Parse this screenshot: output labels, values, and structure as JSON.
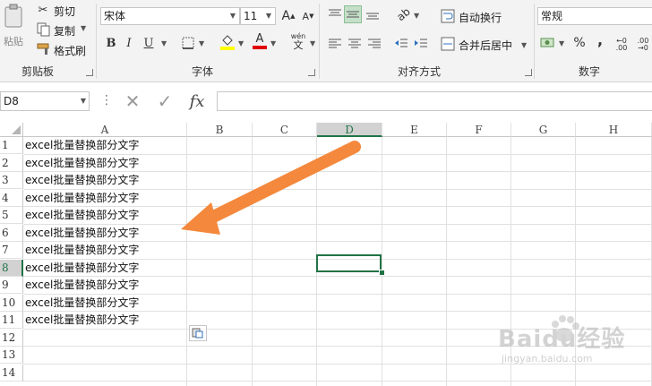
{
  "ribbon": {
    "clipboard": {
      "paste_label": "粘贴",
      "cut_label": "剪切",
      "copy_label": "复制",
      "format_painter_label": "格式刷",
      "group_label": "剪贴板"
    },
    "font": {
      "font_name": "宋体",
      "font_size": "11",
      "bold": "B",
      "italic": "I",
      "underline": "U",
      "grow": "A",
      "shrink": "A",
      "font_color": "A",
      "phonetic": "wén",
      "group_label": "字体"
    },
    "alignment": {
      "wrap_text_label": "自动换行",
      "merge_center_label": "合并后居中",
      "group_label": "对齐方式"
    },
    "number": {
      "format": "常规",
      "percent": "%",
      "comma": ",",
      "group_label": "数字"
    }
  },
  "formula_bar": {
    "name_box": "D8",
    "fx": "fx",
    "formula": ""
  },
  "sheet": {
    "columns": [
      "A",
      "B",
      "C",
      "D",
      "E",
      "F",
      "G",
      "H"
    ],
    "rows": [
      "1",
      "2",
      "3",
      "4",
      "5",
      "6",
      "7",
      "8",
      "9",
      "10",
      "11",
      "12",
      "13",
      "14"
    ],
    "cells_a": [
      "excel批量替换部分文字",
      "excel批量替换部分文字",
      "excel批量替换部分文字",
      "excel批量替换部分文字",
      "excel批量替换部分文字",
      "excel批量替换部分文字",
      "excel批量替换部分文字",
      "excel批量替换部分文字",
      "excel批量替换部分文字",
      "excel批量替换部分文字",
      "excel批量替换部分文字"
    ],
    "selected_cell": "D8",
    "selection_color": "#217346"
  },
  "annotation": {
    "arrow_color": "#f4883c"
  },
  "watermark": {
    "brand": "Baidu经验",
    "url": "jingyan.baidu.com"
  }
}
